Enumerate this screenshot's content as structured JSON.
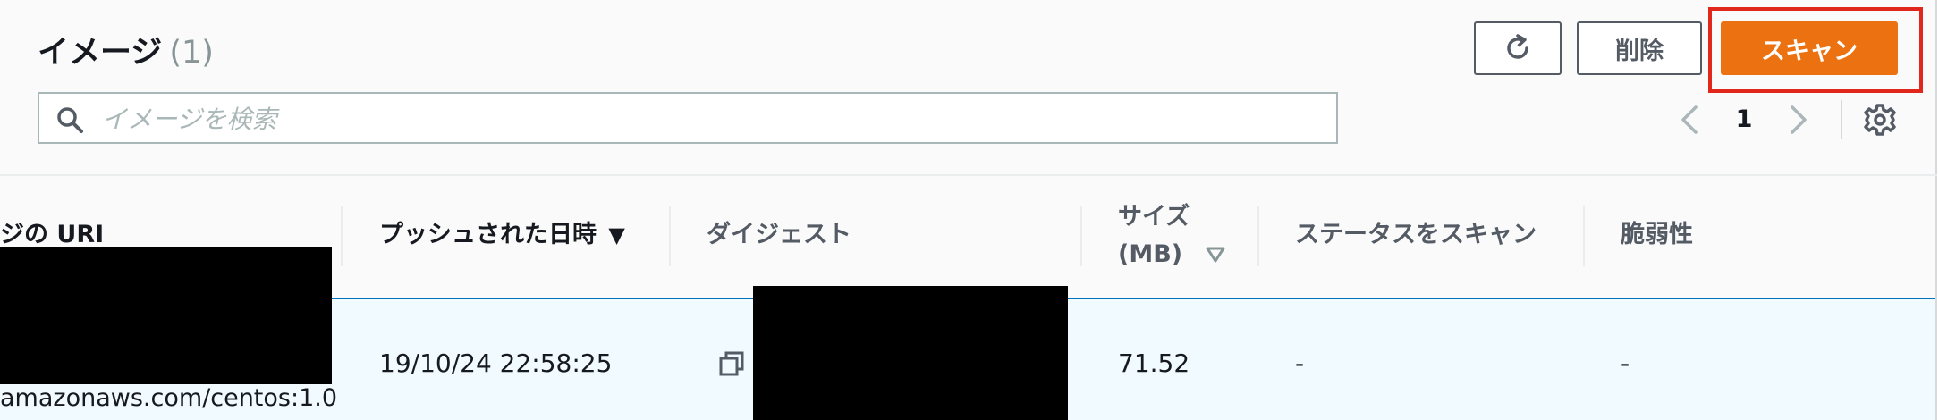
{
  "header": {
    "title": "イメージ",
    "count": "(1)"
  },
  "search": {
    "placeholder": "イメージを検索",
    "value": ""
  },
  "actions": {
    "delete_label": "削除",
    "scan_label": "スキャン"
  },
  "pagination": {
    "current_page": "1"
  },
  "table": {
    "columns": {
      "uri": "ジの URI",
      "pushed_at": "プッシュされた日時",
      "pushed_at_sort": "▼",
      "digest": "ダイジェスト",
      "size_line1": "サイズ",
      "size_line2": "(MB)",
      "scan_status": "ステータスをスキャン",
      "vulnerabilities": "脆弱性"
    },
    "rows": [
      {
        "uri": "amazonaws.com/centos:1.0",
        "pushed_at": "19/10/24 22:58:25",
        "size": "71.52",
        "scan_status": "-",
        "vulnerabilities": "-"
      }
    ]
  },
  "icons": {
    "search": "search-icon",
    "refresh": "refresh-icon",
    "prev": "chevron-left-icon",
    "next": "chevron-right-icon",
    "settings": "gear-icon",
    "sort": "sort-icon",
    "copy": "copy-icon"
  },
  "colors": {
    "primary": "#ec7211",
    "highlight": "#e1261c",
    "selected_row": "#f1faff",
    "selected_border": "#0073bb"
  }
}
